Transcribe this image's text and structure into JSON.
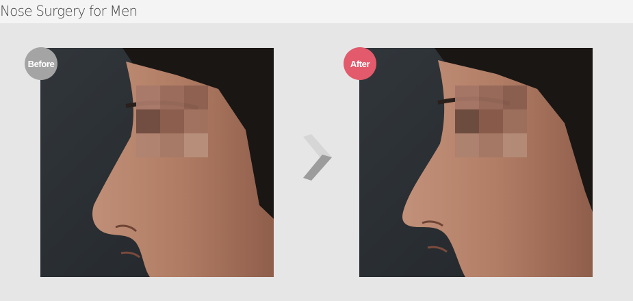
{
  "header": {
    "title": "Nose Surgery for Men"
  },
  "badges": {
    "before_label": "Before",
    "after_label": "After"
  },
  "images": {
    "before": "before-photo",
    "after": "after-photo"
  },
  "icons": {
    "arrow": "chevron-right-icon"
  },
  "colors": {
    "before_badge": "#a4a4a4",
    "after_badge": "#e25a6b",
    "background": "#e6e6e6"
  }
}
